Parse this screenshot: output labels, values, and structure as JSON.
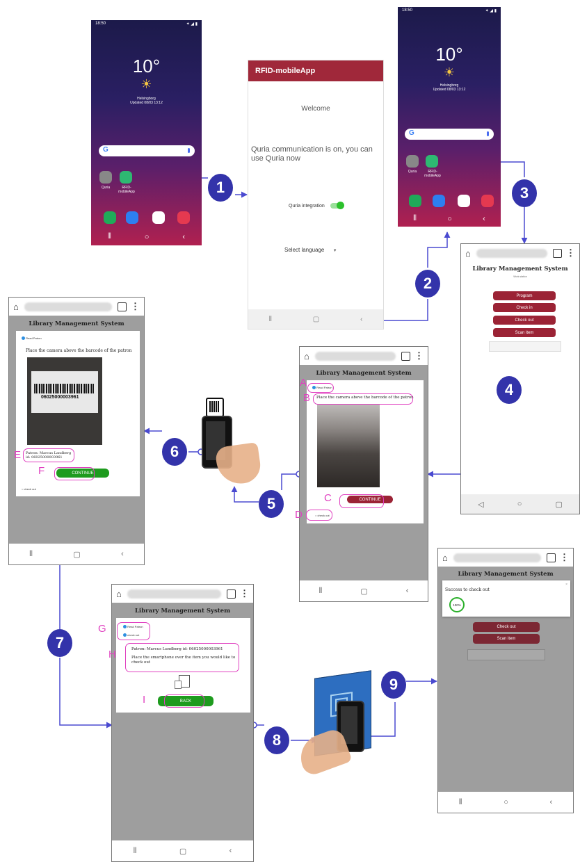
{
  "home_screen": {
    "time": "18:50",
    "temperature": "10°",
    "location": "Helsingborg",
    "updated": "Updated 08/03 13:12",
    "apps": [
      {
        "label": "Quria"
      },
      {
        "label": "RFID-\nmobileApp"
      }
    ]
  },
  "rfid_app": {
    "title": "RFID-mobileApp",
    "welcome": "Welcome",
    "message": "Quria communication is on, you can use Quria now",
    "toggle_label": "Quria integration",
    "language_label": "Select language",
    "accent_color": "#a0283a"
  },
  "lms": {
    "title": "Library Management System",
    "subtitle": "Work station",
    "menu": [
      "Program",
      "Check in",
      "Check out",
      "Scan item"
    ],
    "read_patron": "Read Patron",
    "check_out": "check out",
    "camera_instruction": "Place the camera above the barcode of the patron",
    "continue_label": "CONTINUE",
    "back_label": "BACK",
    "barcode_number": "06025000003961",
    "patron_name_line": "Patron: Marcus Landberg",
    "patron_id_line": "id: 06025000003961",
    "patron_full": "Patron: Marcus Lundberg id: 06025000003961",
    "item_instruction": "Place the smartphone over the item you would like to check out",
    "success_text": "Success to check out",
    "progress_label": "100%"
  },
  "steps": [
    "1",
    "2",
    "3",
    "4",
    "5",
    "6",
    "7",
    "8",
    "9"
  ],
  "letters": [
    "A",
    "B",
    "C",
    "D",
    "E",
    "F",
    "G",
    "H",
    "I"
  ],
  "colors": {
    "step_badge": "#3333aa",
    "connector": "#4a4ad0",
    "highlight": "#e040c0",
    "button_red": "#9b2335",
    "button_green": "#1e9b1e"
  }
}
